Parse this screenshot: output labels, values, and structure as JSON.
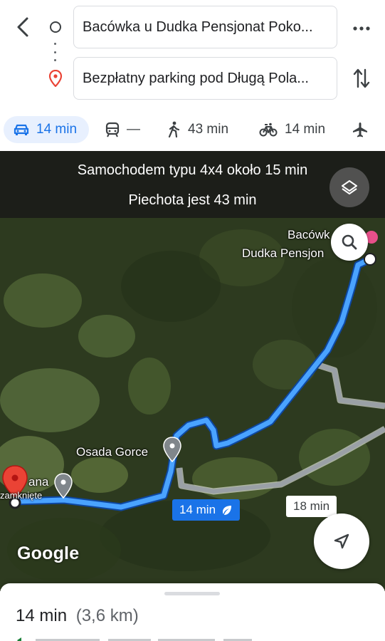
{
  "header": {
    "origin": "Bacówka u Dudka Pensjonat Poko...",
    "destination": "Bezpłatny parking pod Długą Pola..."
  },
  "modes": [
    {
      "id": "car",
      "label": "14 min",
      "icon": "car-icon",
      "active": true
    },
    {
      "id": "transit",
      "label": "—",
      "icon": "transit-icon",
      "active": false
    },
    {
      "id": "walk",
      "label": "43 min",
      "icon": "walk-icon",
      "active": false
    },
    {
      "id": "bike",
      "label": "14 min",
      "icon": "bike-icon",
      "active": false
    },
    {
      "id": "flight",
      "label": "",
      "icon": "flight-icon",
      "active": false
    }
  ],
  "map": {
    "banner_line1": "Samochodem typu 4x4 około 15 min",
    "banner_line2": "Piechota jest 43 min",
    "dest_label_line1": "Bacówk",
    "dest_label_line2": "Dudka Pensjon",
    "poi_label": "Osada Gorce",
    "origin_label_line1": "ana",
    "origin_label_line2": "zamknięte",
    "route_time_main": "14 min",
    "route_time_alt": "18 min",
    "attribution": "Google",
    "route_color": "#1a73e8"
  },
  "sheet": {
    "duration": "14 min",
    "distance": "(3,6 km)"
  },
  "colors": {
    "accent": "#1a73e8",
    "active_tab_bg": "#e8f0fe",
    "pin_red": "#ea4335"
  }
}
